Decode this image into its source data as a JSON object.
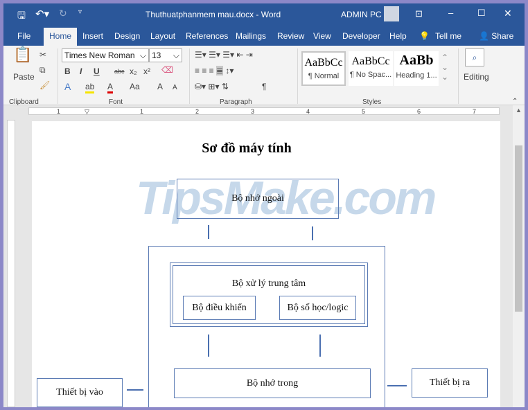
{
  "window": {
    "title": "Thuthuatphanmem mau.docx  -  Word",
    "user": "ADMIN PC"
  },
  "tabs": [
    "File",
    "Home",
    "Insert",
    "Design",
    "Layout",
    "References",
    "Mailings",
    "Review",
    "View",
    "Developer",
    "Help",
    "Tell me",
    "Share"
  ],
  "ribbon": {
    "clipboard": {
      "paste": "Paste",
      "label": "Clipboard"
    },
    "font": {
      "name": "Times New Roman",
      "size": "13",
      "label": "Font",
      "bold": "B",
      "italic": "I",
      "underline": "U",
      "strike": "abc",
      "sub": "x₂",
      "sup": "x²",
      "case": "Aa",
      "grow": "A",
      "shrink": "A"
    },
    "paragraph": {
      "label": "Paragraph",
      "pilcrow": "¶"
    },
    "styles": {
      "label": "Styles",
      "items": [
        {
          "preview": "AaBbCc",
          "name": "¶ Normal"
        },
        {
          "preview": "AaBbCc",
          "name": "¶ No Spac..."
        },
        {
          "preview": "AaBb",
          "name": "Heading 1..."
        }
      ]
    },
    "editing": {
      "label": "Editing"
    }
  },
  "ruler": {
    "marks": [
      "1",
      "1",
      "2",
      "3",
      "4",
      "5",
      "6",
      "7"
    ]
  },
  "document": {
    "title": "Sơ đồ máy tính",
    "watermark": "TipsMake.com",
    "nodes": {
      "external_memory": "Bộ nhớ ngoài",
      "cpu": "Bộ xử lý trung tâm",
      "control_unit": "Bộ điều khiển",
      "alu": "Bộ số học/logic",
      "internal_memory": "Bộ nhớ trong",
      "input": "Thiết bị vào",
      "output": "Thiết bị ra"
    }
  }
}
